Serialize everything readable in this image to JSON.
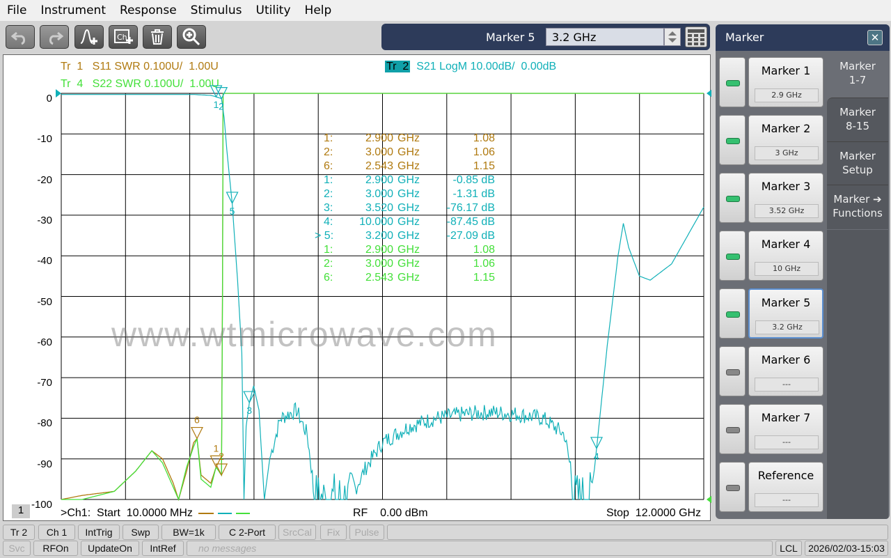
{
  "menu": [
    "File",
    "Instrument",
    "Response",
    "Stimulus",
    "Utility",
    "Help"
  ],
  "toolbar": {
    "icons": [
      "undo-icon",
      "redo-icon",
      "add-trace-icon",
      "add-channel-icon",
      "delete-icon",
      "zoom-icon"
    ]
  },
  "marker_entry": {
    "label": "Marker 5",
    "value": "3.2 GHz"
  },
  "traces": {
    "tr1": {
      "name": "Tr  1",
      "desc": "S11 SWR 0.100U/  1.00U",
      "color": "#b07a10"
    },
    "tr4": {
      "name": "Tr  4",
      "desc": "S22 SWR 0.100U/  1.00U",
      "color": "#44e03a"
    },
    "tr2": {
      "name": "Tr  2",
      "desc": "S21 LogM 10.00dB/  0.00dB",
      "color": "#10b0b8"
    }
  },
  "y_ticks": [
    "0",
    "-10",
    "-20",
    "-30",
    "-40",
    "-50",
    "-60",
    "-70",
    "-80",
    "-90",
    "-100"
  ],
  "marker_table": [
    {
      "n": "1:",
      "f": "2.900",
      "u": "GHz",
      "v": "1.08",
      "c": "tr1"
    },
    {
      "n": "2:",
      "f": "3.000",
      "u": "GHz",
      "v": "1.06",
      "c": "tr1"
    },
    {
      "n": "6:",
      "f": "2.543",
      "u": "GHz",
      "v": "1.15",
      "c": "tr1"
    },
    {
      "n": "1:",
      "f": "2.900",
      "u": "GHz",
      "v": "-0.85 dB",
      "c": "tr2"
    },
    {
      "n": "2:",
      "f": "3.000",
      "u": "GHz",
      "v": "-1.31 dB",
      "c": "tr2"
    },
    {
      "n": "3:",
      "f": "3.520",
      "u": "GHz",
      "v": "-76.17 dB",
      "c": "tr2"
    },
    {
      "n": "4:",
      "f": "10.000",
      "u": "GHz",
      "v": "-87.45 dB",
      "c": "tr2"
    },
    {
      "n": "> 5:",
      "f": "3.200",
      "u": "GHz",
      "v": "-27.09 dB",
      "c": "tr2"
    },
    {
      "n": "1:",
      "f": "2.900",
      "u": "GHz",
      "v": "1.08",
      "c": "tr4"
    },
    {
      "n": "2:",
      "f": "3.000",
      "u": "GHz",
      "v": "1.06",
      "c": "tr4"
    },
    {
      "n": "6:",
      "f": "2.543",
      "u": "GHz",
      "v": "1.15",
      "c": "tr4"
    }
  ],
  "watermark": "www.wtmicrowave.com",
  "channel": {
    "num": "1",
    "start": ">Ch1:  Start  10.0000 MHz",
    "rf": "RF    0.00 dBm",
    "stop": "Stop  12.0000 GHz"
  },
  "s21_points": [
    [
      0.01,
      -0.3
    ],
    [
      2.5,
      -0.3
    ],
    [
      2.8,
      -0.5
    ],
    [
      2.9,
      -0.85
    ],
    [
      3.0,
      -1.31
    ],
    [
      3.05,
      -6
    ],
    [
      3.1,
      -14
    ],
    [
      3.2,
      -27.09
    ],
    [
      3.3,
      -46
    ],
    [
      3.38,
      -64
    ],
    [
      3.42,
      -100
    ],
    [
      3.46,
      -82
    ],
    [
      3.52,
      -76.17
    ],
    [
      3.6,
      -72
    ],
    [
      3.7,
      -78
    ],
    [
      3.8,
      -100
    ],
    [
      3.9,
      -90
    ],
    [
      4.1,
      -80
    ],
    [
      4.4,
      -78
    ],
    [
      4.6,
      -84
    ],
    [
      4.75,
      -100
    ],
    [
      5.4,
      -100
    ],
    [
      5.7,
      -92
    ],
    [
      6.0,
      -86
    ],
    [
      6.5,
      -82
    ],
    [
      7.0,
      -80
    ],
    [
      7.5,
      -79
    ],
    [
      8.0,
      -78.5
    ],
    [
      8.5,
      -79
    ],
    [
      9.0,
      -80
    ],
    [
      9.4,
      -84
    ],
    [
      9.55,
      -95
    ],
    [
      9.6,
      -100
    ],
    [
      9.9,
      -100
    ],
    [
      10.0,
      -87.45
    ],
    [
      10.2,
      -62
    ],
    [
      10.4,
      -40
    ],
    [
      10.5,
      -32
    ],
    [
      10.6,
      -38
    ],
    [
      10.8,
      -45
    ],
    [
      11.0,
      -46
    ],
    [
      11.4,
      -42
    ],
    [
      12.0,
      -28
    ]
  ],
  "s11_points": [
    [
      0.01,
      1.0
    ],
    [
      0.4,
      1.01
    ],
    [
      1.0,
      1.02
    ],
    [
      1.4,
      1.07
    ],
    [
      1.7,
      1.12
    ],
    [
      1.9,
      1.1
    ],
    [
      2.1,
      1.04
    ],
    [
      2.2,
      1.0
    ],
    [
      2.35,
      1.07
    ],
    [
      2.48,
      1.14
    ],
    [
      2.543,
      1.15
    ],
    [
      2.62,
      1.06
    ],
    [
      2.8,
      1.04
    ],
    [
      2.9,
      1.08
    ],
    [
      3.0,
      1.06
    ],
    [
      3.02,
      1.55
    ],
    [
      3.03,
      2.0
    ],
    [
      12.0,
      2.0
    ]
  ],
  "s22_points": [
    [
      0.01,
      1.0
    ],
    [
      0.4,
      1.0
    ],
    [
      1.0,
      1.02
    ],
    [
      1.4,
      1.07
    ],
    [
      1.7,
      1.12
    ],
    [
      1.9,
      1.09
    ],
    [
      2.1,
      1.03
    ],
    [
      2.2,
      1.0
    ],
    [
      2.35,
      1.08
    ],
    [
      2.48,
      1.13
    ],
    [
      2.543,
      1.15
    ],
    [
      2.62,
      1.05
    ],
    [
      2.8,
      1.03
    ],
    [
      2.9,
      1.08
    ],
    [
      3.0,
      1.06
    ],
    [
      3.02,
      1.5
    ],
    [
      3.03,
      2.0
    ],
    [
      12.0,
      2.0
    ]
  ],
  "plot_markers": [
    {
      "label": "1",
      "f": 2.9,
      "t": "s21"
    },
    {
      "label": "2",
      "f": 3.0,
      "t": "s21"
    },
    {
      "label": "5",
      "f": 3.2,
      "t": "s21"
    },
    {
      "label": "3",
      "f": 3.52,
      "t": "s21"
    },
    {
      "label": "4",
      "f": 10.0,
      "t": "s21"
    },
    {
      "label": "6",
      "f": 2.543,
      "t": "s11"
    },
    {
      "label": "1",
      "f": 2.9,
      "t": "s11"
    },
    {
      "label": "2",
      "f": 3.0,
      "t": "s11"
    }
  ],
  "status1": [
    "Tr 2",
    "Ch 1",
    "IntTrig",
    "Swp",
    "BW=1k",
    "C  2-Port",
    "SrcCal",
    "Fix",
    "Pulse"
  ],
  "status2": {
    "svc": "Svc",
    "rfon": "RFOn",
    "update": "UpdateOn",
    "intref": "IntRef",
    "msg": "no messages",
    "lcl": "LCL",
    "time": "2026/02/03-15:03"
  },
  "panel": {
    "title": "Marker",
    "markers": [
      {
        "name": "Marker 1",
        "value": "2.9 GHz",
        "on": true
      },
      {
        "name": "Marker 2",
        "value": "3 GHz",
        "on": true
      },
      {
        "name": "Marker 3",
        "value": "3.52 GHz",
        "on": true
      },
      {
        "name": "Marker 4",
        "value": "10 GHz",
        "on": true
      },
      {
        "name": "Marker 5",
        "value": "3.2 GHz",
        "on": true
      },
      {
        "name": "Marker 6",
        "value": "---",
        "on": false
      },
      {
        "name": "Marker 7",
        "value": "---",
        "on": false
      },
      {
        "name": "Reference",
        "value": "---",
        "on": false
      }
    ],
    "tabs": [
      "Marker\n1-7",
      "Marker\n8-15",
      "Marker\nSetup",
      "Marker ➔\nFunctions"
    ]
  }
}
